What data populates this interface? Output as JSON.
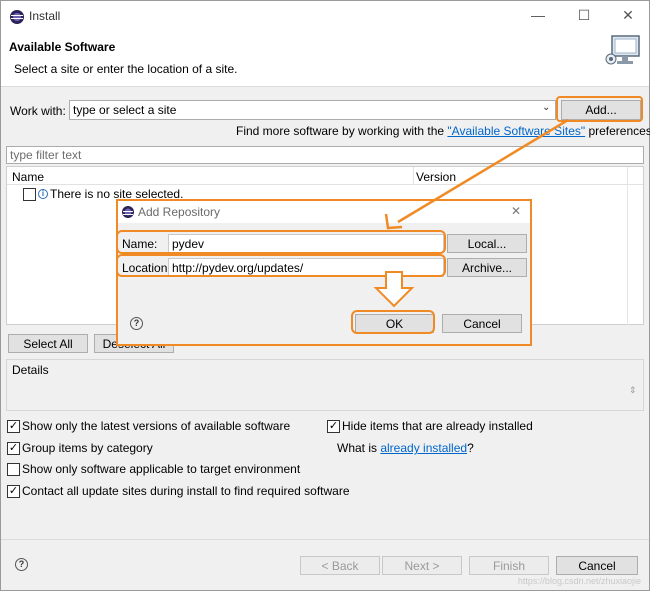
{
  "window": {
    "title": "Install",
    "minimize": "—",
    "maximize": "☐",
    "close": "✕"
  },
  "header": {
    "heading": "Available Software",
    "subtitle": "Select a site or enter the location of a site."
  },
  "work_with": {
    "label": "Work with:",
    "placeholder": "type or select a site",
    "add_button": "Add...",
    "find_more_prefix": "Find more software by working with the ",
    "find_more_link": "\"Available Software Sites\"",
    "find_more_suffix": " preferences."
  },
  "filter": {
    "placeholder": "type filter text"
  },
  "table": {
    "columns": [
      "Name",
      "Version"
    ],
    "empty_message": "There is no site selected."
  },
  "list_buttons": {
    "select_all": "Select All",
    "deselect_all": "Deselect All"
  },
  "details": {
    "label": "Details"
  },
  "options": {
    "show_latest": {
      "label": "Show only the latest versions of available software",
      "checked": true
    },
    "group_by_category": {
      "label": "Group items by category",
      "checked": true
    },
    "applicable_only": {
      "label": "Show only software applicable to target environment",
      "checked": false
    },
    "contact_all_sites": {
      "label": "Contact all update sites during install to find required software",
      "checked": true
    },
    "hide_installed": {
      "label": "Hide items that are already installed",
      "checked": true
    },
    "what_is_prefix": "What is ",
    "what_is_link": "already installed",
    "what_is_suffix": "?"
  },
  "footer": {
    "back": "< Back",
    "next": "Next >",
    "finish": "Finish",
    "cancel": "Cancel"
  },
  "dialog": {
    "title": "Add Repository",
    "name_label": "Name:",
    "name_value": "pydev",
    "location_label": "Location:",
    "location_value": "http://pydev.org/updates/",
    "local_button": "Local...",
    "archive_button": "Archive...",
    "ok_button": "OK",
    "cancel_button": "Cancel",
    "close": "✕"
  },
  "watermark": "https://blog.csdn.net/zhuxiaojie",
  "colors": {
    "annotation": "#f08a24",
    "link": "#0066cc"
  }
}
